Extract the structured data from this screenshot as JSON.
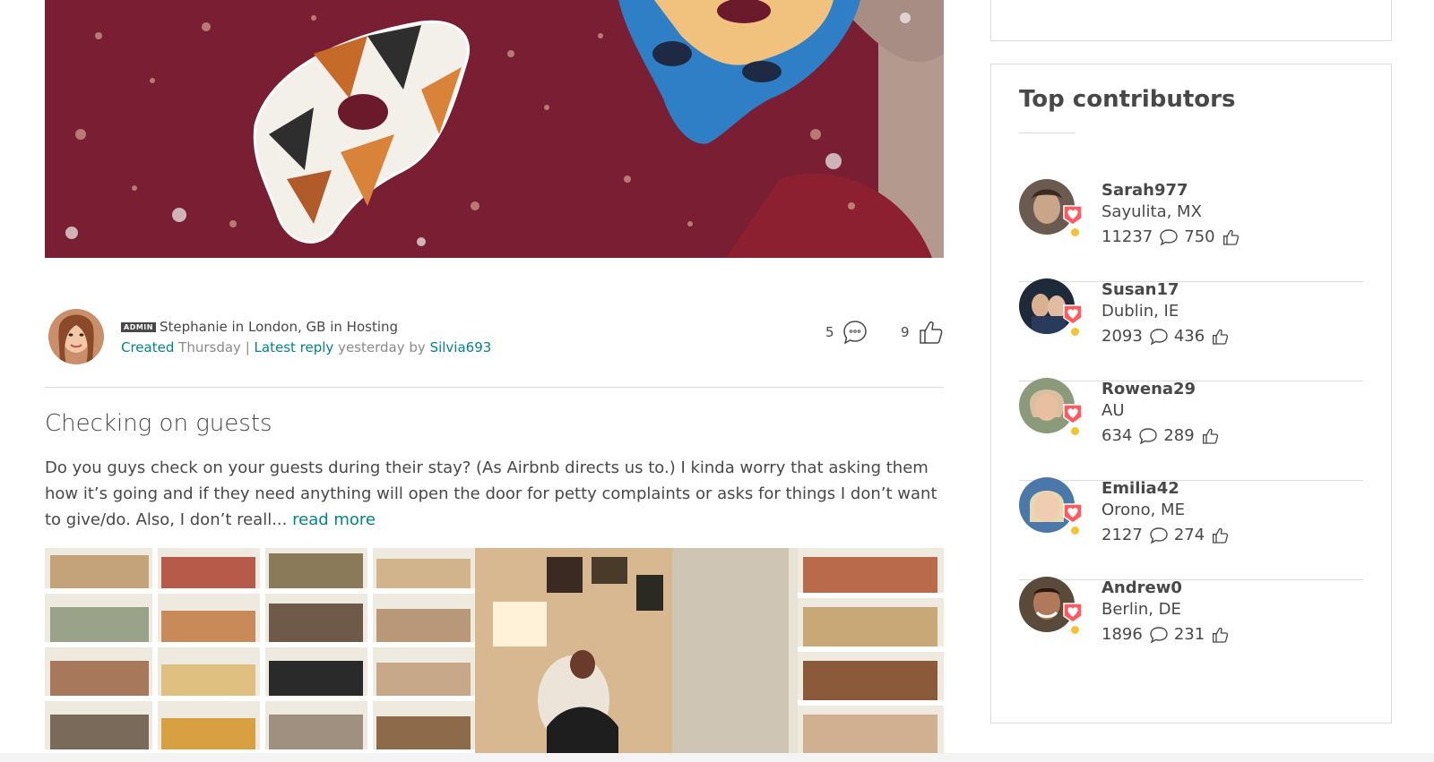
{
  "post": {
    "author_badge": "ADMIN",
    "author": "Stephanie",
    "in1": "in",
    "location": "London, GB",
    "in2": "in",
    "board": "Hosting",
    "created_label": "Created",
    "created_day": "Thursday",
    "separator": "|",
    "latest_reply_label": "Latest reply",
    "latest_reply_when": "yesterday by",
    "latest_reply_user": "Silvia693",
    "comments_count": "5",
    "likes_count": "9"
  },
  "next_post": {
    "title": "Checking on guests",
    "excerpt": "Do you guys check on your guests during their stay? (As Airbnb directs us to.) I kinda worry that asking them how it’s going and if they need anything will open the door for petty complaints or asks for things I don’t want to give/do. Also, I don’t reall...",
    "read_more": "read more"
  },
  "sidebar": {
    "title": "Top contributors",
    "contributors": [
      {
        "name": "Sarah977",
        "location": "Sayulita, MX",
        "posts": "11237",
        "likes": "750"
      },
      {
        "name": "Susan17",
        "location": "Dublin, IE",
        "posts": "2093",
        "likes": "436"
      },
      {
        "name": "Rowena29",
        "location": "AU",
        "posts": "634",
        "likes": "289"
      },
      {
        "name": "Emilia42",
        "location": "Orono, ME",
        "posts": "2127",
        "likes": "274"
      },
      {
        "name": "Andrew0",
        "location": "Berlin, DE",
        "posts": "1896",
        "likes": "231"
      }
    ]
  },
  "colors": {
    "link": "#008489",
    "text": "#484848",
    "muted": "#8a8a8a",
    "badge": "#ff5a5f",
    "status_dot": "#f4c430"
  },
  "icons": {
    "comments": "speech-bubble-icon",
    "likes": "thumbs-up-icon",
    "contributor_badge": "heart-shield-icon"
  }
}
